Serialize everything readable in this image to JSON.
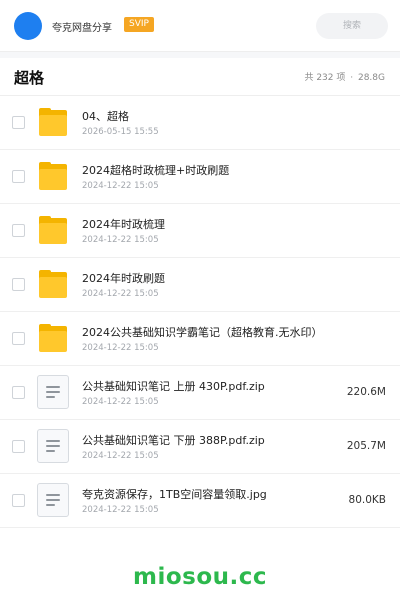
{
  "header": {
    "share_name": "夸克网盘分享",
    "badge": "SVIP",
    "search_placeholder": "搜索"
  },
  "folder": {
    "title": "超格",
    "count_label": "共 232 项",
    "separator": "·",
    "total_size": "28.8G"
  },
  "items": [
    {
      "type": "folder",
      "name": "04、超格",
      "date": "2026-05-15 15:55",
      "size": ""
    },
    {
      "type": "folder",
      "name": "2024超格时政梳理+时政刷题",
      "date": "2024-12-22 15:05",
      "size": ""
    },
    {
      "type": "folder",
      "name": "2024年时政梳理",
      "date": "2024-12-22 15:05",
      "size": ""
    },
    {
      "type": "folder",
      "name": "2024年时政刷题",
      "date": "2024-12-22 15:05",
      "size": ""
    },
    {
      "type": "folder",
      "name": "2024公共基础知识学霸笔记（超格教育.无水印）",
      "date": "2024-12-22 15:05",
      "size": ""
    },
    {
      "type": "file",
      "name": "公共基础知识笔记  上册  430P.pdf.zip",
      "date": "2024-12-22 15:05",
      "size": "220.6M"
    },
    {
      "type": "file",
      "name": "公共基础知识笔记  下册  388P.pdf.zip",
      "date": "2024-12-22 15:05",
      "size": "205.7M"
    },
    {
      "type": "file",
      "name": "夸克资源保存，1TB空间容量领取.jpg",
      "date": "2024-12-22 15:05",
      "size": "80.0KB"
    }
  ],
  "footer": {
    "watermark": "miosou.cc"
  },
  "colors": {
    "avatar": "#1e7ff0",
    "badge": "#f5a623",
    "folder": "#ffc82c",
    "watermark": "#2db84d"
  }
}
